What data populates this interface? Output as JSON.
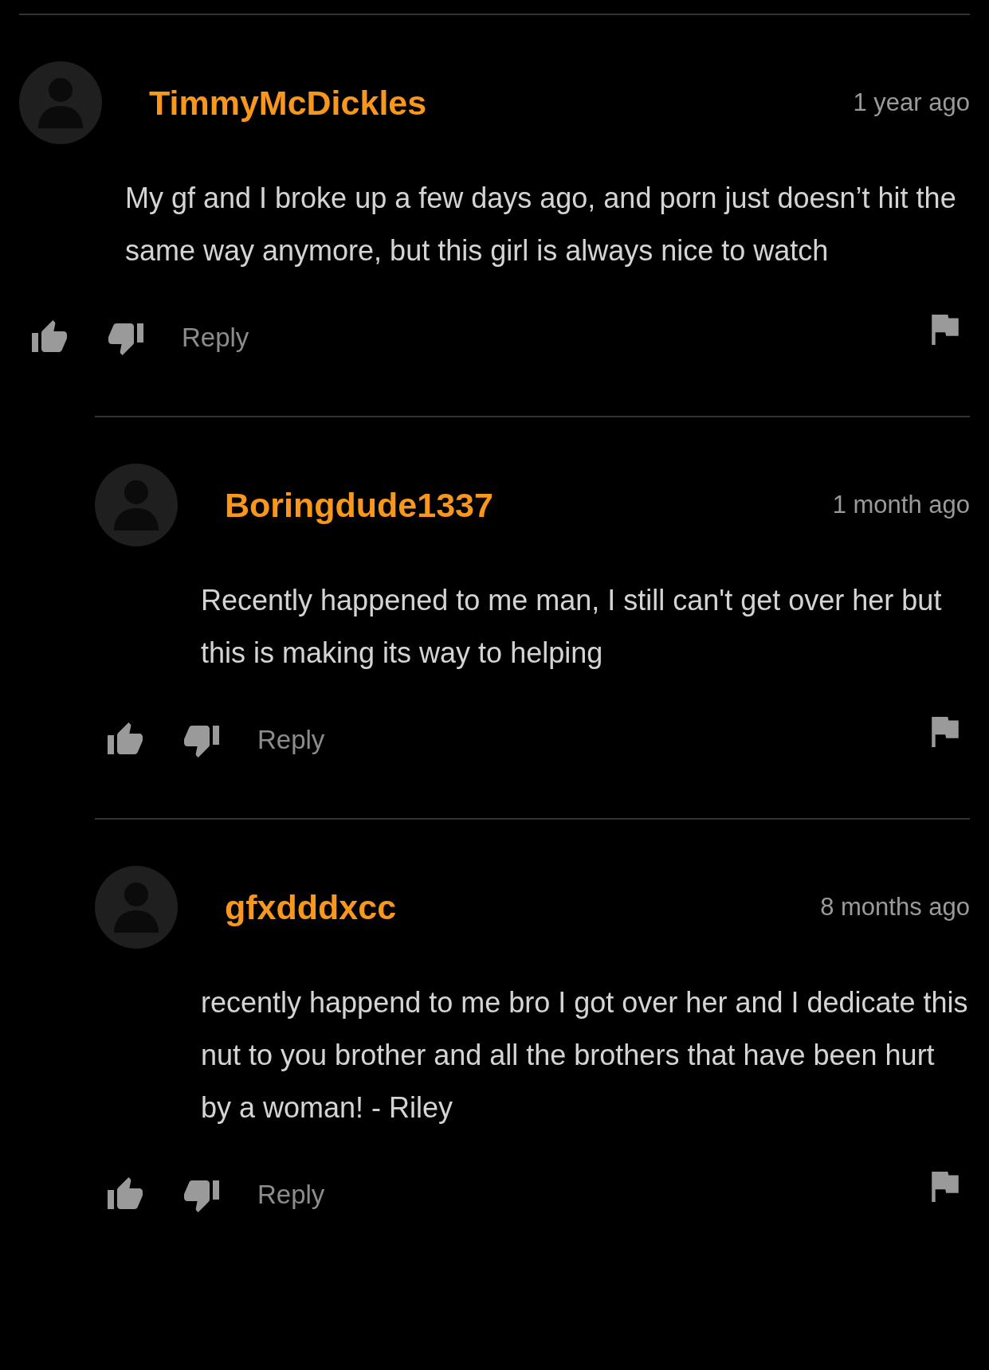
{
  "comments": [
    {
      "user": "TimmyMcDickles",
      "time": "1 year ago",
      "text": "My gf and I broke up a few days ago, and porn just doesn’t hit the same way anymore, but this girl is always nice to watch",
      "reply_label": "Reply",
      "replies": [
        {
          "user": "Boringdude1337",
          "time": "1 month ago",
          "text": "Recently happened to me man, I still can't get over her but this is making its way to helping",
          "reply_label": "Reply"
        },
        {
          "user": "gfxdddxcc",
          "time": "8 months ago",
          "text": "recently happend to me bro I got over her and I dedicate this nut to you brother and all the brothers that have been hurt by a woman! - Riley",
          "reply_label": "Reply"
        }
      ]
    }
  ]
}
